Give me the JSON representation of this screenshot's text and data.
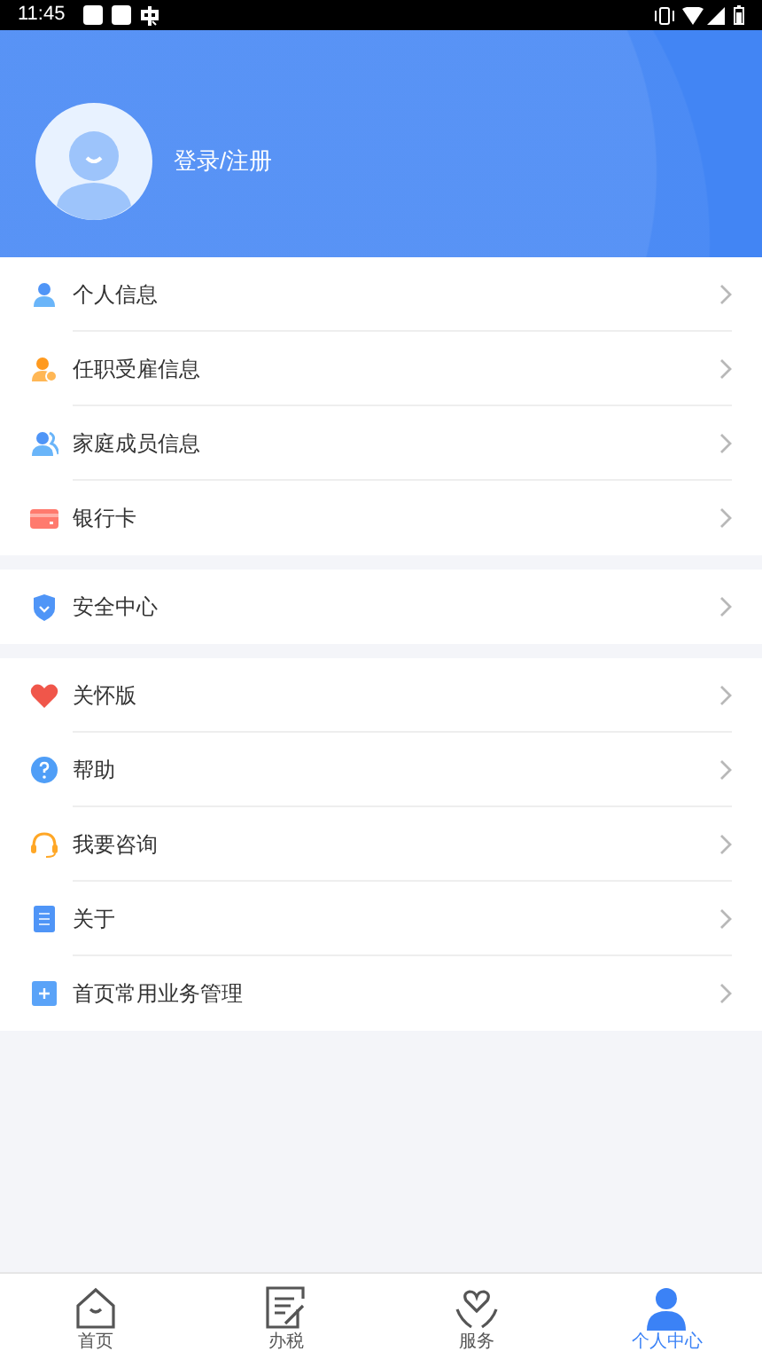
{
  "status_bar": {
    "time": "11:45"
  },
  "profile": {
    "login_label": "登录/注册"
  },
  "menu_groups": [
    {
      "items": [
        {
          "kind": "person",
          "label": "个人信息"
        },
        {
          "kind": "employment",
          "label": "任职受雇信息"
        },
        {
          "kind": "family",
          "label": "家庭成员信息"
        },
        {
          "kind": "card",
          "label": "银行卡"
        }
      ]
    },
    {
      "items": [
        {
          "kind": "shield",
          "label": "安全中心"
        }
      ]
    },
    {
      "items": [
        {
          "kind": "heart",
          "label": "关怀版"
        },
        {
          "kind": "help",
          "label": "帮助"
        },
        {
          "kind": "headset",
          "label": "我要咨询"
        },
        {
          "kind": "document",
          "label": "关于"
        },
        {
          "kind": "plus",
          "label": "首页常用业务管理"
        }
      ]
    }
  ],
  "tab_bar": [
    {
      "kind": "home",
      "label": "首页",
      "selected": false
    },
    {
      "kind": "tax",
      "label": "办税",
      "selected": false
    },
    {
      "kind": "service",
      "label": "服务",
      "selected": false
    },
    {
      "kind": "profile",
      "label": "个人中心",
      "selected": true
    }
  ]
}
